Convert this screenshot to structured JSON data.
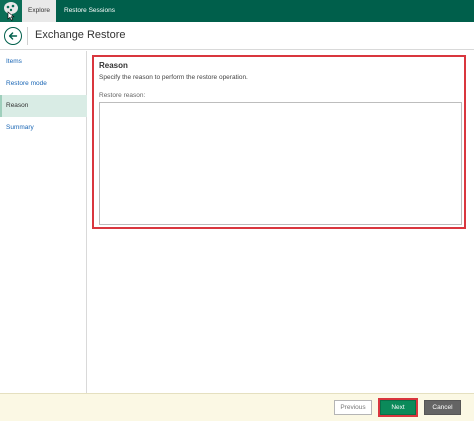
{
  "app": {
    "tabs": [
      {
        "label": "Explore",
        "active": true
      },
      {
        "label": "Restore Sessions",
        "active": false
      }
    ]
  },
  "header": {
    "title": "Exchange Restore"
  },
  "sidebar": {
    "items": [
      {
        "label": "Items",
        "active": false
      },
      {
        "label": "Restore mode",
        "active": false
      },
      {
        "label": "Reason",
        "active": true
      },
      {
        "label": "Summary",
        "active": false
      }
    ]
  },
  "main": {
    "section_title": "Reason",
    "description": "Specify the reason to perform the restore operation.",
    "field_label": "Restore reason:",
    "field_value": ""
  },
  "footer": {
    "previous_label": "Previous",
    "next_label": "Next",
    "cancel_label": "Cancel"
  },
  "colors": {
    "topbar": "#005f4b",
    "accent": "#0b8a5a",
    "highlight": "#d9363e",
    "sidebar_active": "#d9ece5",
    "footer_bg": "#fbf8e4"
  }
}
